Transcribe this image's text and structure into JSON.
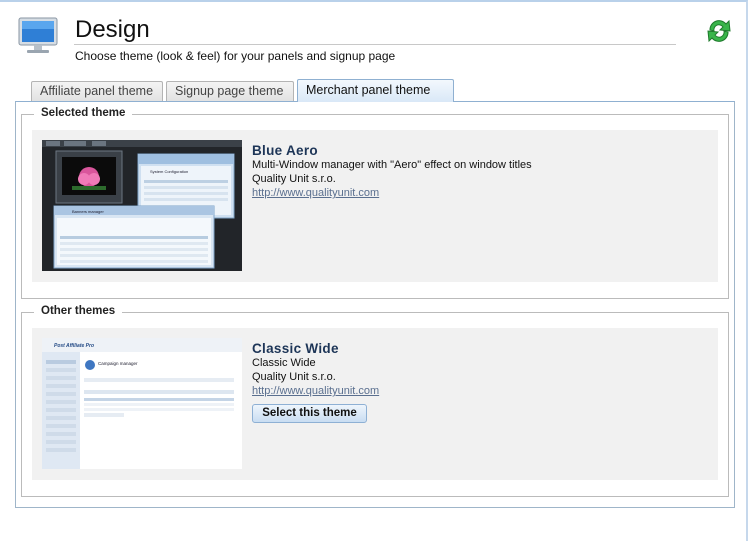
{
  "header": {
    "title": "Design",
    "subtitle": "Choose theme (look & feel) for your panels and signup page",
    "icon": "monitor-icon",
    "refresh_icon": "refresh-icon"
  },
  "tabs": [
    {
      "label": "Affiliate panel theme",
      "active": false
    },
    {
      "label": "Signup page theme",
      "active": false
    },
    {
      "label": "Merchant panel theme",
      "active": true
    }
  ],
  "selected_theme": {
    "legend": "Selected theme",
    "name": "Blue Aero",
    "description": "Multi-Window manager with \"Aero\" effect on window titles",
    "author": "Quality Unit s.r.o.",
    "url": "http://www.qualityunit.com",
    "thumbnail_title": "System Configuration",
    "thumbnail_subtitle": "Banners manager"
  },
  "other_themes": {
    "legend": "Other themes",
    "items": [
      {
        "name": "Classic Wide",
        "description": "Classic Wide",
        "author": "Quality Unit s.r.o.",
        "url": "http://www.qualityunit.com",
        "button_label": "Select this theme",
        "thumbnail_logo": "Post Affiliate Pro",
        "thumbnail_title": "Campaign manager"
      }
    ]
  },
  "colors": {
    "accent": "#8fb0d1",
    "theme_name": "#1d3557",
    "link": "#5a6f8f",
    "card_bg": "#f1f1f1"
  }
}
